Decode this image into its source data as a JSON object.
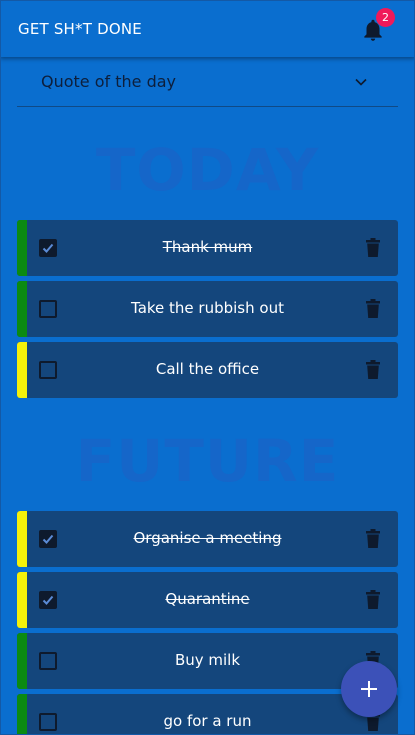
{
  "app": {
    "title": "GET SH*T DONE",
    "notifications": {
      "icon": "bell-icon",
      "count": "2"
    }
  },
  "quote": {
    "label": "Quote of the day",
    "icon": "chevron-down-icon"
  },
  "sections": {
    "today": "TODAY",
    "future": "FUTURE"
  },
  "today_tasks": [
    {
      "label": "Thank mum",
      "done": true,
      "priority_color": "#0b8a12"
    },
    {
      "label": "Take the rubbish out",
      "done": false,
      "priority_color": "#0b8a12"
    },
    {
      "label": "Call the office",
      "done": false,
      "priority_color": "#f5f10a"
    }
  ],
  "future_tasks": [
    {
      "label": "Organise a meeting",
      "done": true,
      "priority_color": "#f5f10a"
    },
    {
      "label": "Quarantine",
      "done": true,
      "priority_color": "#f5f10a"
    },
    {
      "label": "Buy milk",
      "done": false,
      "priority_color": "#0b8a12"
    },
    {
      "label": "go for a run",
      "done": false,
      "priority_color": "#0b8a12"
    }
  ],
  "fab": {
    "icon": "plus-icon"
  },
  "colors": {
    "background": "#0a6ecf",
    "card": "#14467c",
    "badge": "#f0195a",
    "fab": "#3c51b8"
  }
}
